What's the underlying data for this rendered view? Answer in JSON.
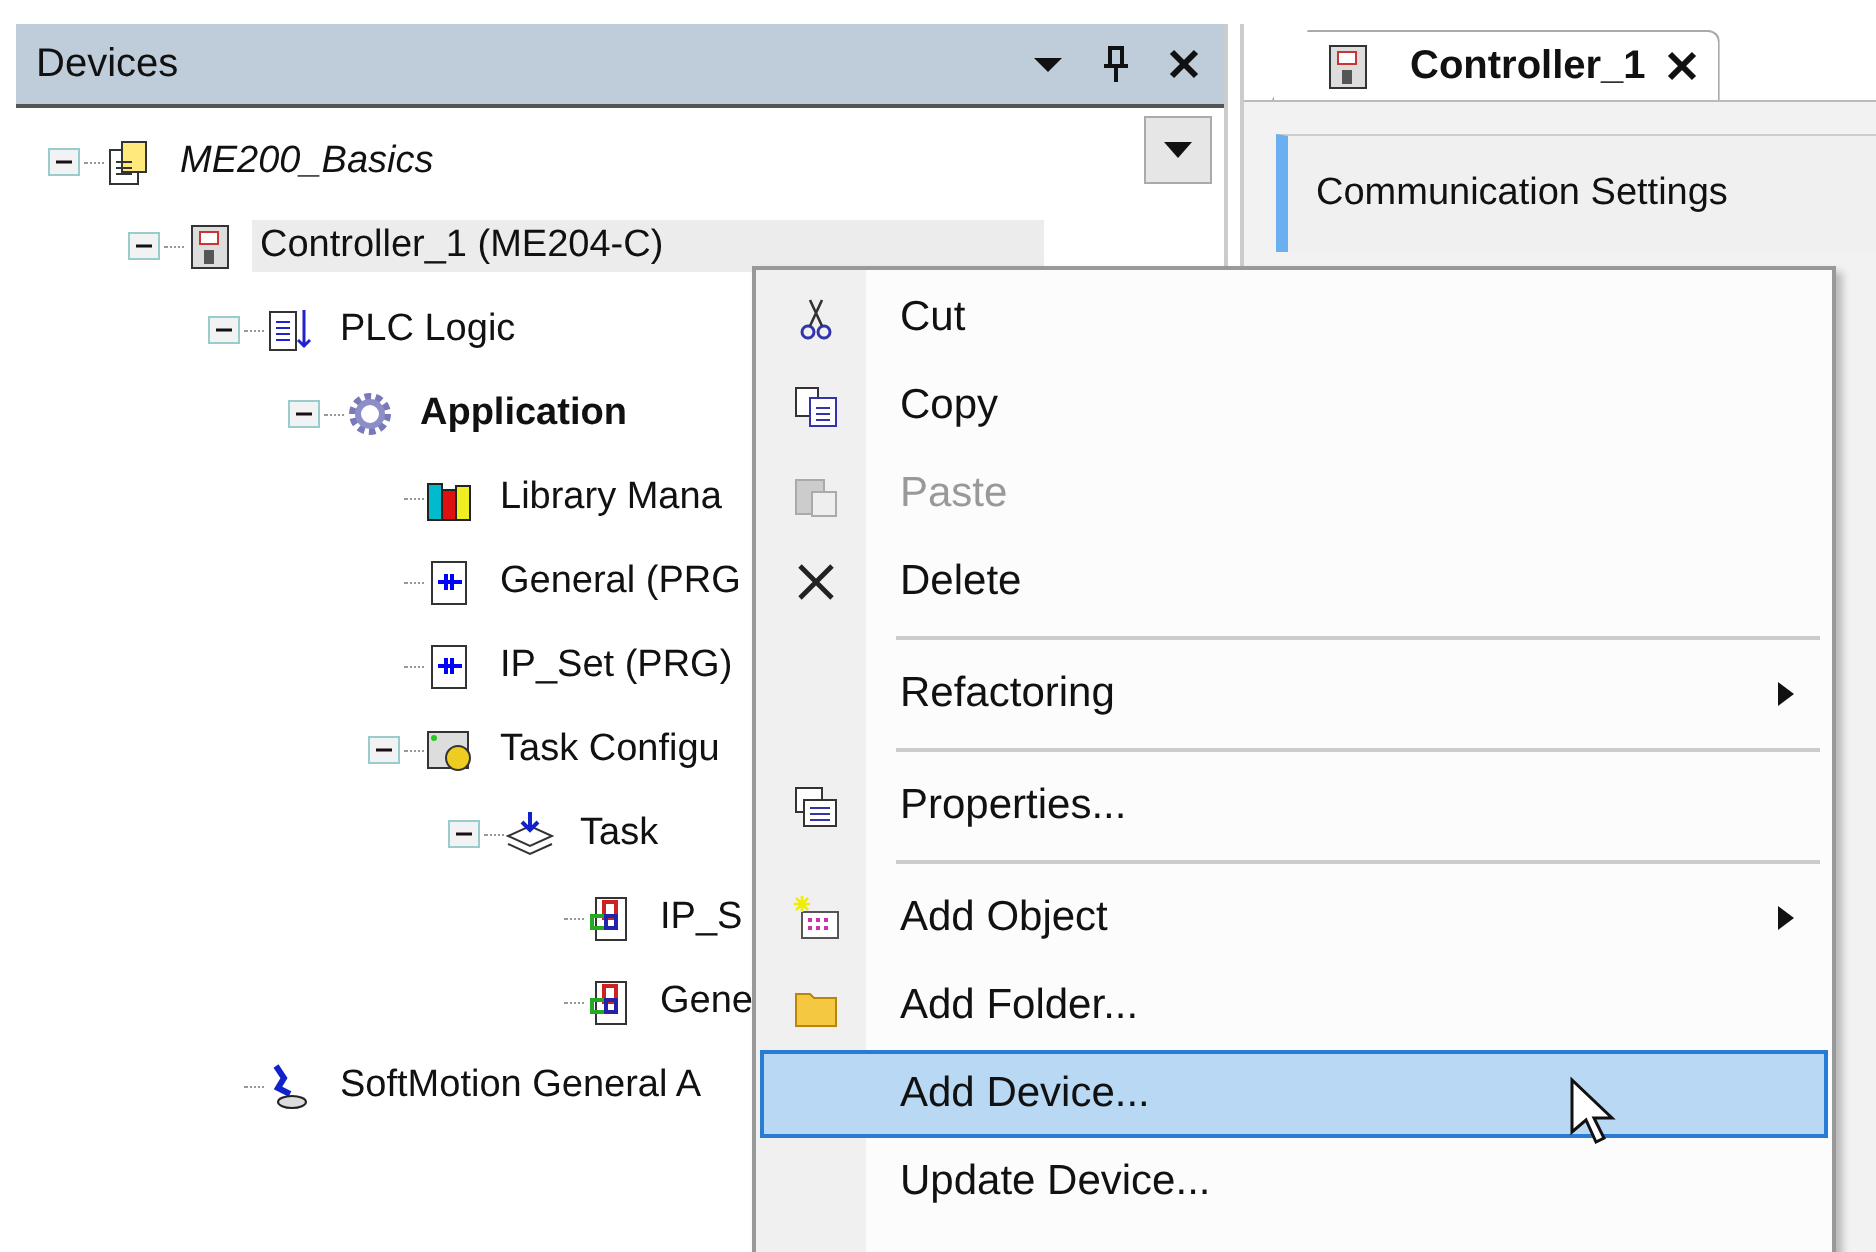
{
  "devices_panel": {
    "title": "Devices",
    "tree": [
      {
        "kind": "project",
        "label": "ME200_Basics",
        "expanded": true,
        "selected": false,
        "children": [
          {
            "kind": "controller",
            "label": "Controller_1 (ME204-C)",
            "expanded": true,
            "selected": true,
            "children": [
              {
                "kind": "plc-logic",
                "label": "PLC Logic",
                "expanded": true,
                "selected": false,
                "children": [
                  {
                    "kind": "application",
                    "label": "Application",
                    "expanded": true,
                    "selected": false,
                    "children": [
                      {
                        "kind": "library",
                        "label": "Library Mana",
                        "selected": false
                      },
                      {
                        "kind": "pou",
                        "label": "General (PRG",
                        "selected": false
                      },
                      {
                        "kind": "pou",
                        "label": "IP_Set (PRG)",
                        "selected": false
                      },
                      {
                        "kind": "task-config",
                        "label": "Task Configu",
                        "expanded": true,
                        "selected": false,
                        "children": [
                          {
                            "kind": "task",
                            "label": "Task",
                            "expanded": true,
                            "selected": false,
                            "children": [
                              {
                                "kind": "task-call",
                                "label": "IP_S",
                                "selected": false
                              },
                              {
                                "kind": "task-call",
                                "label": "Gene",
                                "selected": false
                              }
                            ]
                          }
                        ]
                      }
                    ]
                  }
                ]
              },
              {
                "kind": "softmotion",
                "label": "SoftMotion General A",
                "selected": false
              }
            ]
          }
        ]
      }
    ]
  },
  "editor": {
    "tab": {
      "label": "Controller_1",
      "selected": true
    },
    "sections": [
      "Communication Settings"
    ]
  },
  "context_menu": [
    {
      "kind": "item",
      "label": "Cut",
      "disabled": false,
      "selected": false,
      "submenu": false
    },
    {
      "kind": "item",
      "label": "Copy",
      "disabled": false,
      "selected": false,
      "submenu": false
    },
    {
      "kind": "item",
      "label": "Paste",
      "disabled": true,
      "selected": false,
      "submenu": false
    },
    {
      "kind": "item",
      "label": "Delete",
      "disabled": false,
      "selected": false,
      "submenu": false
    },
    {
      "kind": "separator"
    },
    {
      "kind": "item",
      "label": "Refactoring",
      "disabled": false,
      "selected": false,
      "submenu": true
    },
    {
      "kind": "separator"
    },
    {
      "kind": "item",
      "label": "Properties...",
      "disabled": false,
      "selected": false,
      "submenu": false
    },
    {
      "kind": "separator"
    },
    {
      "kind": "item",
      "label": "Add Object",
      "disabled": false,
      "selected": false,
      "submenu": true
    },
    {
      "kind": "item",
      "label": "Add Folder...",
      "disabled": false,
      "selected": false,
      "submenu": false
    },
    {
      "kind": "item",
      "label": "Add Device...",
      "disabled": false,
      "selected": true,
      "submenu": false
    },
    {
      "kind": "item",
      "label": "Update Device...",
      "disabled": false,
      "selected": false,
      "submenu": false
    }
  ]
}
